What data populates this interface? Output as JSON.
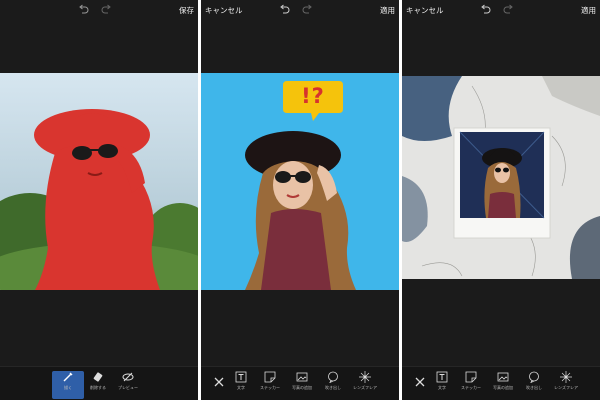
{
  "panel1": {
    "top_right": "保存",
    "tools": [
      {
        "label": "描く",
        "icon": "brush-icon",
        "active": true
      },
      {
        "label": "削除する",
        "icon": "eraser-icon"
      },
      {
        "label": "プレビュー",
        "icon": "eye-off-icon"
      }
    ]
  },
  "panel2": {
    "top_left": "キャンセル",
    "top_right": "適用",
    "sticker_text": "!?",
    "tools": [
      {
        "label": "文字",
        "icon": "text-icon"
      },
      {
        "label": "ステッカー",
        "icon": "sticker-icon"
      },
      {
        "label": "写真の追加",
        "icon": "add-photo-icon"
      },
      {
        "label": "吹き出し",
        "icon": "speech-bubble-icon"
      },
      {
        "label": "レンズフレア",
        "icon": "lens-flare-icon"
      }
    ]
  },
  "panel3": {
    "top_left": "キャンセル",
    "top_right": "適用",
    "tools": [
      {
        "label": "文字",
        "icon": "text-icon"
      },
      {
        "label": "ステッカー",
        "icon": "sticker-icon"
      },
      {
        "label": "写真の追加",
        "icon": "add-photo-icon"
      },
      {
        "label": "吹き出し",
        "icon": "speech-bubble-icon"
      },
      {
        "label": "レンズフレア",
        "icon": "lens-flare-icon"
      }
    ]
  },
  "colors": {
    "bg_dark": "#1b1b1b",
    "accent_blue": "#2f5fa8",
    "cyan_bg": "#3fb6ea",
    "sticker_yellow": "#f5c30c",
    "sticker_red": "#d6322e",
    "overlay_red": "#d9352f"
  }
}
